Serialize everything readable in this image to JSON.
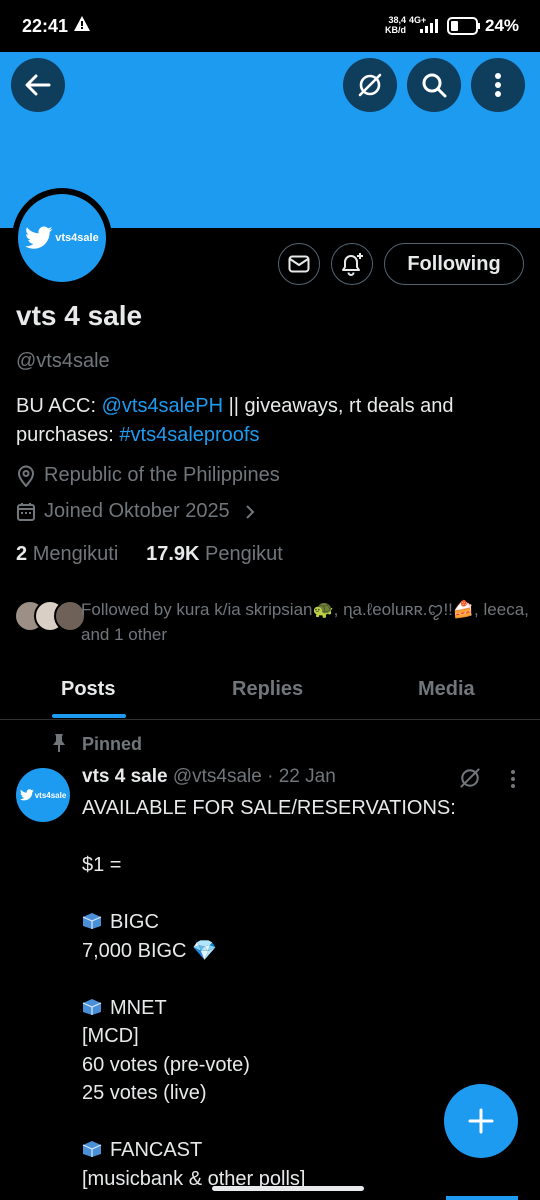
{
  "status_bar": {
    "time": "22:41",
    "net_speed_value": "38,4",
    "net_speed_unit": "KB/d",
    "network_type": "4G+",
    "battery": "24%"
  },
  "profile": {
    "name": "vts 4 sale",
    "handle": "@vts4sale",
    "avatar_text": "vts4sale",
    "bio_prefix": "BU ACC: ",
    "bio_link1": "@vts4salePH",
    "bio_middle": " || giveaways, rt deals and purchases: ",
    "bio_link2": "#vts4saleproofs",
    "location": "Republic of the Philippines",
    "joined": "Joined Oktober 2025",
    "following_count": "2",
    "following_label": "Mengikuti",
    "followers_count": "17.9K",
    "followers_label": "Pengikut",
    "followed_by": "Followed by kura k/ia skripsian🐢, ɳa.ℓeoluʀʀ.ꨄ!!🍰, leeca, and 1 other",
    "following_button": "Following"
  },
  "tabs": [
    "Posts",
    "Replies",
    "Media"
  ],
  "active_tab": "Posts",
  "post": {
    "pinned_label": "Pinned",
    "author_name": "vts 4 sale",
    "author_meta": "@vts4sale · 22 Jan",
    "avatar_text": "vts4sale",
    "line1": "AVAILABLE FOR SALE/RESERVATIONS:",
    "line2": "$1 =",
    "line3": "BIGC",
    "line4": "7,000 BIGC 💎",
    "line5": "MNET",
    "line6": "[MCD]",
    "line7": "60 votes (pre-vote)",
    "line8": "25 votes (live)",
    "line9": "FANCAST",
    "line10": "[musicbank & other polls]"
  },
  "colors": {
    "accent": "#1d9bf0",
    "background": "#000000",
    "text_primary": "#e7e9ea",
    "text_secondary": "#71767b"
  },
  "icons": [
    "back-arrow-icon",
    "grok-icon",
    "search-icon",
    "more-vertical-icon",
    "mail-icon",
    "bell-plus-icon",
    "location-pin-icon",
    "calendar-icon",
    "chevron-right-icon",
    "pin-icon",
    "cube-icon",
    "plus-icon"
  ]
}
